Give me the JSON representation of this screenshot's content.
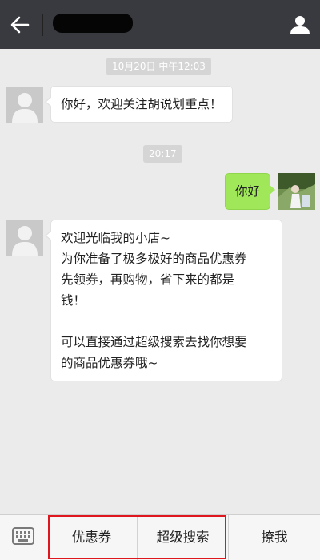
{
  "header": {
    "title": "",
    "back_icon": "arrow-left-icon",
    "profile_icon": "person-icon"
  },
  "messages": [
    {
      "type": "time",
      "text": "10月20日 中午12:03"
    },
    {
      "type": "incoming",
      "lines": [
        "你好，欢迎关注胡说划重点！"
      ]
    },
    {
      "type": "time",
      "text": "20:17"
    },
    {
      "type": "outgoing",
      "lines": [
        "你好"
      ]
    },
    {
      "type": "incoming",
      "lines": [
        "欢迎光临我的小店~",
        "为你准备了极多极好的商品优惠券",
        "先领券，再购物，省下来的都是",
        "钱！",
        "",
        "可以直接通过超级搜索去找你想要",
        "的商品优惠券哦~"
      ]
    }
  ],
  "bottom_menu": {
    "keyboard_icon": "keyboard-icon",
    "items": [
      "优惠券",
      "超级搜索",
      "撩我"
    ]
  },
  "colors": {
    "header_bg": "#393a3f",
    "chat_bg": "#ebebeb",
    "outgoing_bubble": "#a0e75a",
    "highlight_border": "#e0161f"
  }
}
